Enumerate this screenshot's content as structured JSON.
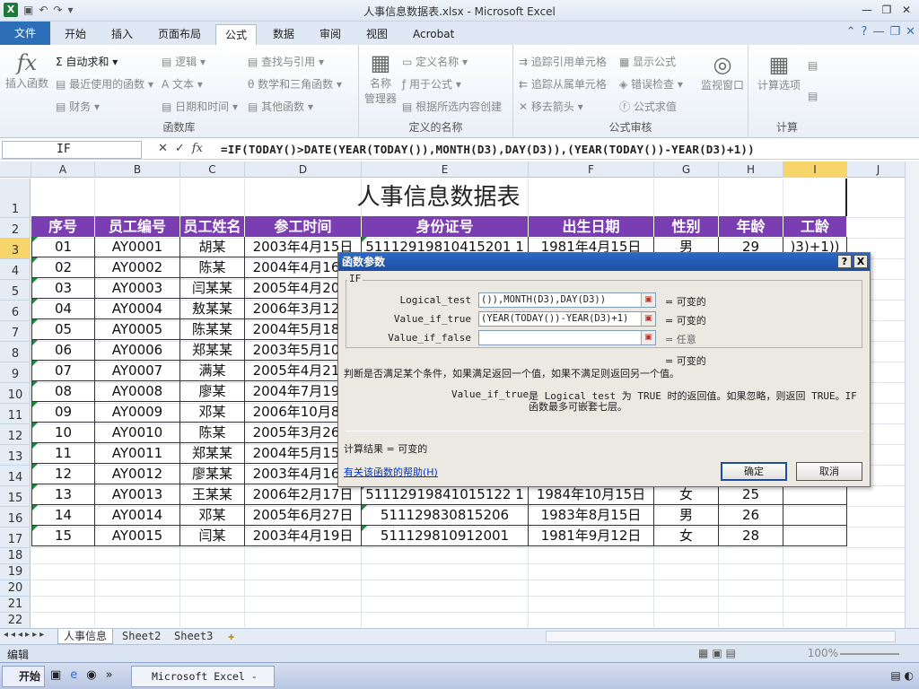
{
  "window": {
    "title": "人事信息数据表.xlsx - Microsoft Excel",
    "app_badge": "X"
  },
  "ribbon": {
    "file_tab": "文件",
    "tabs": [
      "开始",
      "插入",
      "页面布局",
      "公式",
      "数据",
      "审阅",
      "视图",
      "Acrobat"
    ],
    "active_tab": "公式",
    "groups": {
      "function_library": {
        "label": "函数库",
        "insert_function": "插入函数",
        "autosum": "自动求和",
        "recent": "最近使用的函数",
        "financial": "财务",
        "logical": "逻辑",
        "text": "文本",
        "datetime": "日期和时间",
        "lookup": "查找与引用",
        "math": "数学和三角函数",
        "other": "其他函数"
      },
      "defined_names": {
        "label": "定义的名称",
        "name_manager_1": "名称",
        "name_manager_2": "管理器",
        "define_name": "定义名称",
        "use_in_formula": "用于公式",
        "create_from_selection": "根据所选内容创建"
      },
      "formula_auditing": {
        "label": "公式审核",
        "trace_precedents": "追踪引用单元格",
        "trace_dependents": "追踪从属单元格",
        "remove_arrows": "移去箭头",
        "show_formulas": "显示公式",
        "error_checking": "错误检查",
        "evaluate": "公式求值",
        "watch_window": "监视窗口"
      },
      "calculation": {
        "label": "计算",
        "options": "计算选项"
      }
    }
  },
  "formula_bar": {
    "name_box": "IF",
    "formula": "=IF(TODAY()>DATE(YEAR(TODAY()),MONTH(D3),DAY(D3)),(YEAR(TODAY())-YEAR(D3)+1))"
  },
  "sheet": {
    "columns": [
      "A",
      "B",
      "C",
      "D",
      "E",
      "F",
      "G",
      "H",
      "I",
      "J"
    ],
    "selected_column": "I",
    "rows": [
      "1",
      "2",
      "3",
      "4",
      "5",
      "6",
      "7",
      "8",
      "9",
      "10",
      "11",
      "12",
      "13",
      "14",
      "15",
      "16",
      "17",
      "18",
      "19",
      "20",
      "21",
      "22"
    ],
    "selected_row": "3",
    "title": "人事信息数据表",
    "headers": [
      "序号",
      "员工编号",
      "员工姓名",
      "参工时间",
      "身份证号",
      "出生日期",
      "性别",
      "年龄",
      "工龄"
    ],
    "data": [
      [
        "01",
        "AY0001",
        "胡某",
        "2003年4月15日",
        "51112919810415201 1",
        "1981年4月15日",
        "男",
        "29",
        ")3)+1))"
      ],
      [
        "02",
        "AY0002",
        "陈某",
        "2004年4月16日",
        "",
        "",
        "",
        "",
        ""
      ],
      [
        "03",
        "AY0003",
        "闫某某",
        "2005年4月20日",
        "",
        "",
        "",
        "",
        ""
      ],
      [
        "04",
        "AY0004",
        "敖某某",
        "2006年3月12日",
        "",
        "",
        "",
        "",
        ""
      ],
      [
        "05",
        "AY0005",
        "陈某某",
        "2004年5月18日",
        "",
        "",
        "",
        "",
        ""
      ],
      [
        "06",
        "AY0006",
        "郑某某",
        "2003年5月10日",
        "",
        "",
        "",
        "",
        ""
      ],
      [
        "07",
        "AY0007",
        "满某",
        "2005年4月21日",
        "",
        "",
        "",
        "",
        ""
      ],
      [
        "08",
        "AY0008",
        "廖某",
        "2004年7月19日",
        "",
        "",
        "",
        "",
        ""
      ],
      [
        "09",
        "AY0009",
        "邓某",
        "2006年10月8日",
        "",
        "",
        "",
        "",
        ""
      ],
      [
        "10",
        "AY0010",
        "陈某",
        "2005年3月26日",
        "",
        "",
        "",
        "",
        ""
      ],
      [
        "11",
        "AY0011",
        "郑某某",
        "2004年5月15日",
        "",
        "",
        "",
        "",
        ""
      ],
      [
        "12",
        "AY0012",
        "廖某某",
        "2003年4月16日",
        "",
        "",
        "",
        "",
        ""
      ],
      [
        "13",
        "AY0013",
        "王某某",
        "2006年2月17日",
        "51112919841015122 1",
        "1984年10月15日",
        "女",
        "25",
        ""
      ],
      [
        "14",
        "AY0014",
        "邓某",
        "2005年6月27日",
        "511129830815206",
        "1983年8月15日",
        "男",
        "26",
        ""
      ],
      [
        "15",
        "AY0015",
        "闫某",
        "2003年4月19日",
        "511129810912001",
        "1981年9月12日",
        "女",
        "28",
        ""
      ]
    ],
    "tabs": [
      "人事信息",
      "Sheet2",
      "Sheet3"
    ],
    "active_tab": "人事信息"
  },
  "status_bar": {
    "mode": "编辑",
    "zoom": "100%"
  },
  "taskbar": {
    "start": "开始",
    "task": "Microsoft Excel - ..."
  },
  "dialog": {
    "title": "函数参数",
    "help_btn": "?",
    "close_btn": "X",
    "function_name": "IF",
    "args": [
      {
        "name": "Logical_test",
        "value": "()),MONTH(D3),DAY(D3))",
        "result": "= 可变的"
      },
      {
        "name": "Value_if_true",
        "value": "(YEAR(TODAY())-YEAR(D3)+1)",
        "result": "= 可变的"
      },
      {
        "name": "Value_if_false",
        "value": "",
        "result": "= 任意"
      }
    ],
    "overall_result": "= 可变的",
    "description": "判断是否满足某个条件，如果满足返回一个值，如果不满足则返回另一个值。",
    "arg_help_name": "Value_if_true",
    "arg_help_line1": "是 Logical_test 为 TRUE 时的返回值。如果忽略，则返回 TRUE。IF",
    "arg_help_line2": "函数最多可嵌套七层。",
    "calc_result": "计算结果 =  可变的",
    "help_link": "有关该函数的帮助(H)",
    "ok": "确定",
    "cancel": "取消"
  },
  "colors": {
    "header_purple": "#7a3db2",
    "file_tab_blue": "#2c6fb8",
    "dialog_title_blue": "#1c4fa0",
    "selection_yellow": "#f7d56a"
  }
}
